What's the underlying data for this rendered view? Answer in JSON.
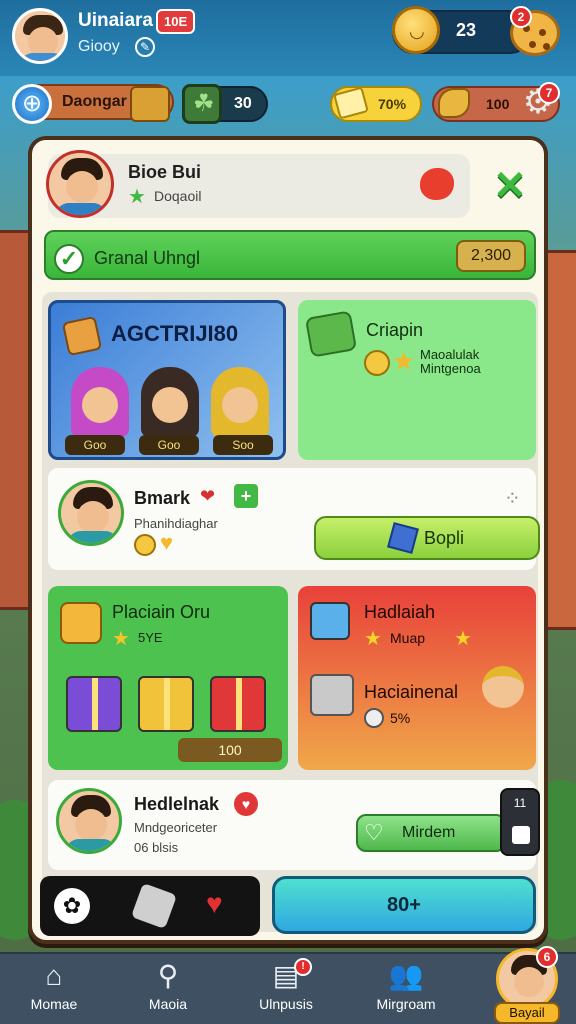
{
  "top": {
    "player_name": "Uinaiara",
    "level_badge": "10E",
    "subtitle": "Giooy",
    "coins": "23",
    "cookie_badge": "2"
  },
  "resources": {
    "globe_label": "Daongar",
    "dark_value": "30",
    "yellow_value": "70%",
    "brown_value": "100",
    "gear_badge": "7"
  },
  "profile": {
    "name": "Bioe Bui",
    "sub": "Doqaoil"
  },
  "banner": {
    "label": "Granal Uhngl",
    "value": "2,300"
  },
  "card_blue": {
    "title": "AGCTRIJI80",
    "labels": [
      "Goo",
      "Goo",
      "Soo"
    ]
  },
  "card_green": {
    "title": "Criapin",
    "sub": "Maoalulak Mintgenoa"
  },
  "card_white": {
    "name": "Bmark",
    "sub": "Phanihdiaghar",
    "button": "Bopli"
  },
  "card_gift": {
    "title": "Placiain Oru",
    "sub": "5YE",
    "bar": "100"
  },
  "card_orange": {
    "title1": "Hadlaiah",
    "sub1": "Muap",
    "title2": "Haciainenal",
    "sub2": "5%"
  },
  "card_bottom": {
    "name": "Hedlelnak",
    "sub1": "Mndgeoriceter",
    "sub2": "06 blsis",
    "button": "Mirdem",
    "counter": "11"
  },
  "bottom_button": "80+",
  "nav": {
    "items": [
      {
        "label": "Momae",
        "icon": "home-icon"
      },
      {
        "label": "Maoia",
        "icon": "search-icon"
      },
      {
        "label": "Ulnpusis",
        "icon": "cards-icon"
      },
      {
        "label": "Mirgroam",
        "icon": "friends-icon"
      }
    ],
    "profile_label": "Bayail",
    "profile_badge": "6"
  }
}
